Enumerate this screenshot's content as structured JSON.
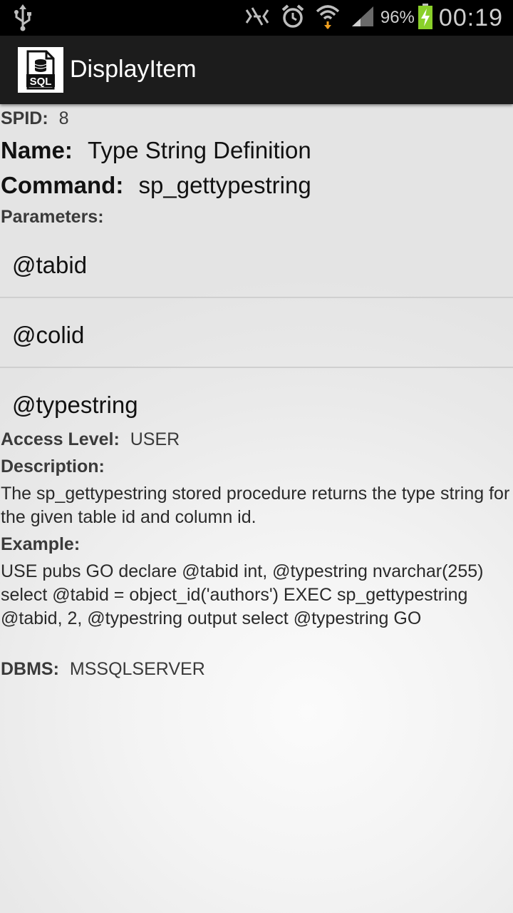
{
  "status_bar": {
    "icons": [
      "usb-icon",
      "no-signal-icon",
      "alarm-icon",
      "wifi-icon",
      "cell-signal-icon",
      "battery-charging-icon"
    ],
    "battery": "96%",
    "time": "00:19"
  },
  "action_bar": {
    "title": "DisplayItem",
    "icon_text": "SQL"
  },
  "item": {
    "spid_label": "SPID:",
    "spid": "8",
    "name_label": "Name:",
    "name": "Type String Definition",
    "command_label": "Command:",
    "command": "sp_gettypestring",
    "parameters_label": "Parameters:",
    "parameters": [
      "@tabid",
      "@colid",
      "@typestring"
    ],
    "access_label": "Access Level:",
    "access": "USER",
    "description_label": "Description:",
    "description": "The sp_gettypestring stored procedure returns the type string for the given table id and column id.",
    "example_label": "Example:",
    "example": "USE pubs GO declare @tabid int, @typestring nvarchar(255) select @tabid = object_id('authors') EXEC sp_gettypestring @tabid, 2, @typestring output select @typestring GO",
    "dbms_label": "DBMS:",
    "dbms": "MSSQLSERVER"
  }
}
